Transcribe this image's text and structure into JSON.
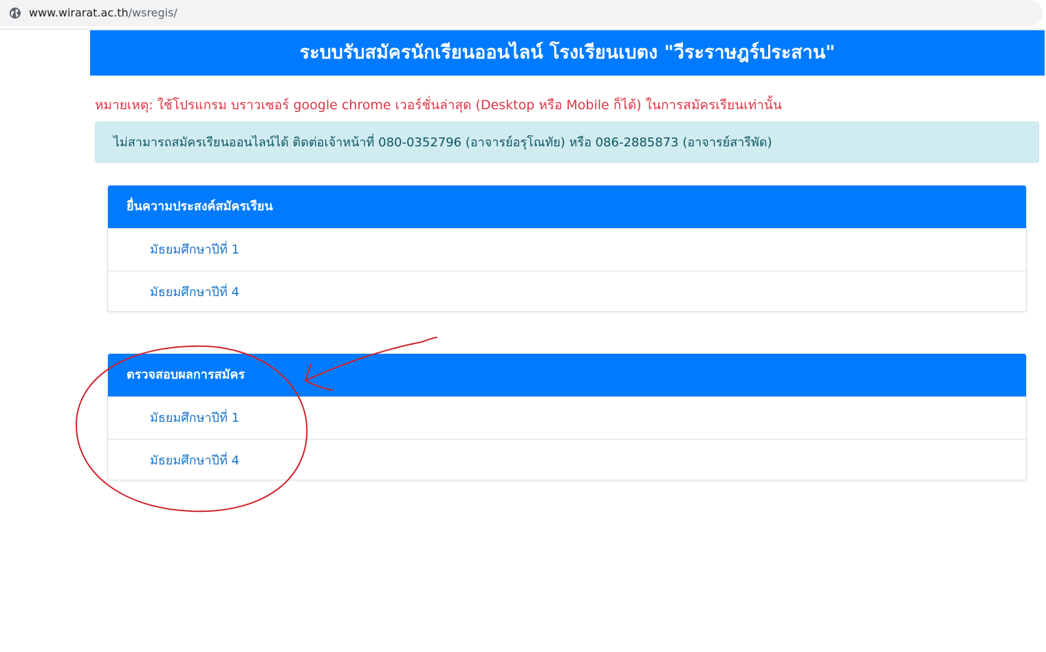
{
  "address_bar": {
    "host": "www.wirarat.ac.th",
    "path": "/wsregis/"
  },
  "header": {
    "title": "ระบบรับสมัครนักเรียนออนไลน์ โรงเรียนเบตง \"วีระราษฎร์ประสาน\""
  },
  "note": "หมายเหตุ: ใช้โปรแกรม บราวเซอร์ google chrome เวอร์ชั่นล่าสุด (Desktop หรือ Mobile ก็ได้) ในการสมัครเรียนเท่านั้น",
  "alert": "ไม่สามารถสมัครเรียนออนไลน์ได้ ติดต่อเจ้าหน้าที่ 080-0352796 (อาจารย์อรุโณทัย) หรือ 086-2885873 (อาจารย์สารีพัด)",
  "cards": [
    {
      "title": "ยื่นความประสงค์สมัครเรียน",
      "items": [
        "มัธยมศึกษาปีที่ 1",
        "มัธยมศึกษาปีที่ 4"
      ]
    },
    {
      "title": "ตรวจสอบผลการสมัคร",
      "items": [
        "มัธยมศึกษาปีที่ 1",
        "มัธยมศึกษาปีที่ 4"
      ]
    }
  ],
  "colors": {
    "primary": "#007bff",
    "danger": "#dc3545",
    "info_bg": "#d1ecf1",
    "info_text": "#0c5460",
    "link": "#1a73c8",
    "annotation": "#d0202a"
  },
  "icons": {
    "address_bar": "globe-icon"
  }
}
